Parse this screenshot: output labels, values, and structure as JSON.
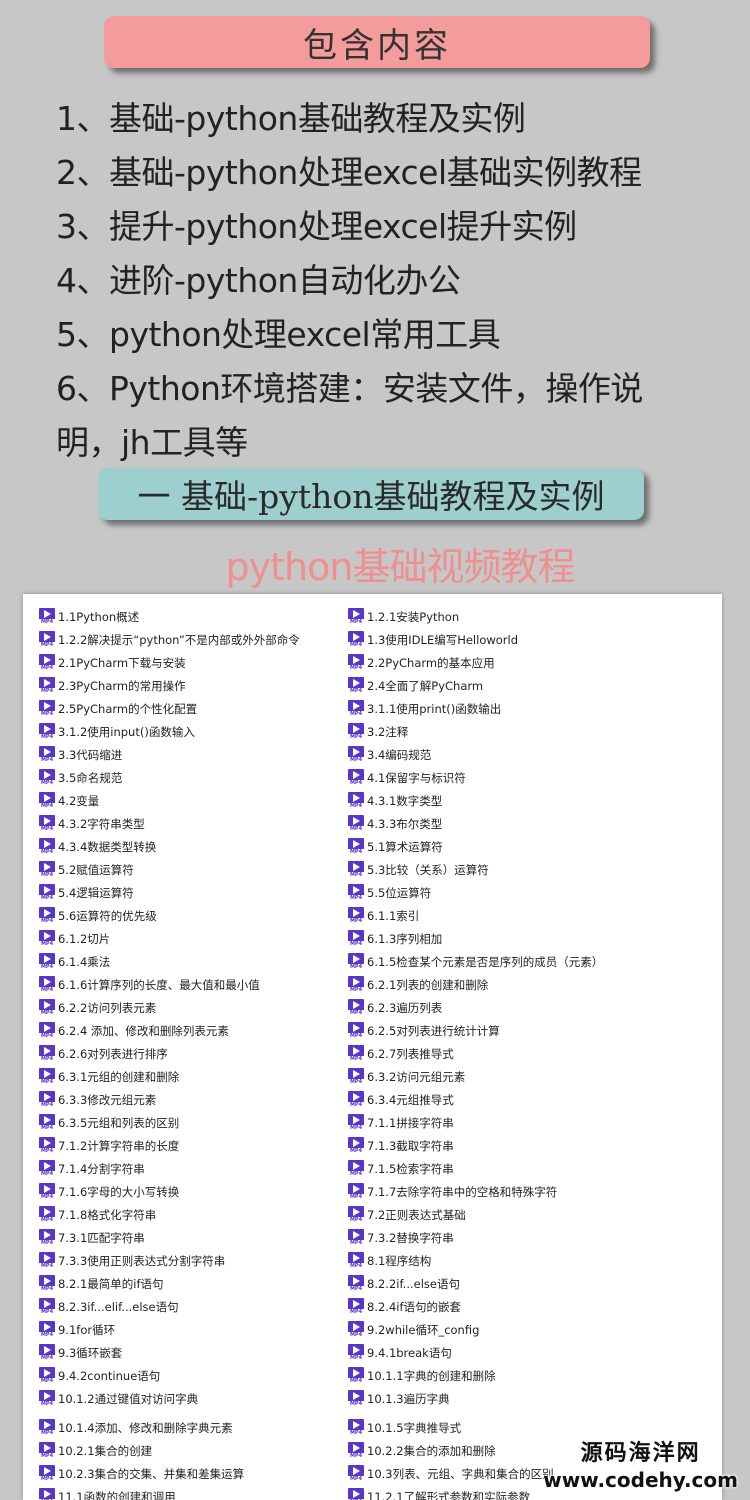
{
  "header": {
    "title": "包含内容"
  },
  "contents": [
    "1、基础-python基础教程及实例",
    "2、基础-python处理excel基础实例教程",
    "3、提升-python处理excel提升实例",
    "4、进阶-python自动化办公",
    "5、python处理excel常用工具",
    "6、Python环境搭建：安装文件，操作说明，jh工具等"
  ],
  "section": {
    "title": "一 基础-python基础教程及实例",
    "subtitle": "python基础视频教程"
  },
  "file_icon": "mp4-video-icon",
  "files": {
    "left": [
      "1.1Python概述",
      "1.2.2解决提示“python”不是内部或外外部命令",
      "2.1PyCharm下载与安装",
      "2.3PyCharm的常用操作",
      "2.5PyCharm的个性化配置",
      "3.1.2使用input()函数输入",
      "3.3代码缩进",
      "3.5命名规范",
      "4.2变量",
      "4.3.2字符串类型",
      "4.3.4数据类型转换",
      "5.2赋值运算符",
      "5.4逻辑运算符",
      "5.6运算符的优先级",
      "6.1.2切片",
      "6.1.4乘法",
      "6.1.6计算序列的长度、最大值和最小值",
      "6.2.2访问列表元素",
      "6.2.4 添加、修改和删除列表元素",
      "6.2.6对列表进行排序",
      "6.3.1元组的创建和删除",
      "6.3.3修改元组元素",
      "6.3.5元组和列表的区别",
      "7.1.2计算字符串的长度",
      "7.1.4分割字符串",
      "7.1.6字母的大小写转换",
      "7.1.8格式化字符串",
      "7.3.1匹配字符串",
      "7.3.3使用正则表达式分割字符串",
      "8.2.1最简单的if语句",
      "8.2.3if...elif...else语句",
      "9.1for循环",
      "9.3循环嵌套",
      "9.4.2continue语句",
      "10.1.2通过键值对访问字典",
      "10.1.4添加、修改和删除字典元素",
      "10.2.1集合的创建",
      "10.2.3集合的交集、并集和差集运算",
      "11.1函数的创建和调用"
    ],
    "right": [
      "1.2.1安装Python",
      "1.3使用IDLE编写Helloworld",
      "2.2PyCharm的基本应用",
      "2.4全面了解PyCharm",
      "3.1.1使用print()函数输出",
      "3.2注释",
      "3.4编码规范",
      "4.1保留字与标识符",
      "4.3.1数字类型",
      "4.3.3布尔类型",
      "5.1算术运算符",
      "5.3比较（关系）运算符",
      "5.5位运算符",
      "6.1.1索引",
      "6.1.3序列相加",
      "6.1.5检查某个元素是否是序列的成员（元素）",
      "6.2.1列表的创建和删除",
      "6.2.3遍历列表",
      "6.2.5对列表进行统计计算",
      "6.2.7列表推导式",
      "6.3.2访问元组元素",
      "6.3.4元组推导式",
      "7.1.1拼接字符串",
      "7.1.3截取字符串",
      "7.1.5检索字符串",
      "7.1.7去除字符串中的空格和特殊字符",
      "7.2正则表达式基础",
      "7.3.2替换字符串",
      "8.1程序结构",
      "8.2.2if...else语句",
      "8.2.4if语句的嵌套",
      "9.2while循环_config",
      "9.4.1break语句",
      "10.1.1字典的创建和删除",
      "10.1.3遍历字典",
      "10.1.5字典推导式",
      "10.2.2集合的添加和删除",
      "10.3列表、元组、字典和集合的区别",
      "11.2.1了解形式参数和实际参数"
    ]
  },
  "watermark": {
    "name": "源码海洋网",
    "url": "www.codehy.com"
  }
}
